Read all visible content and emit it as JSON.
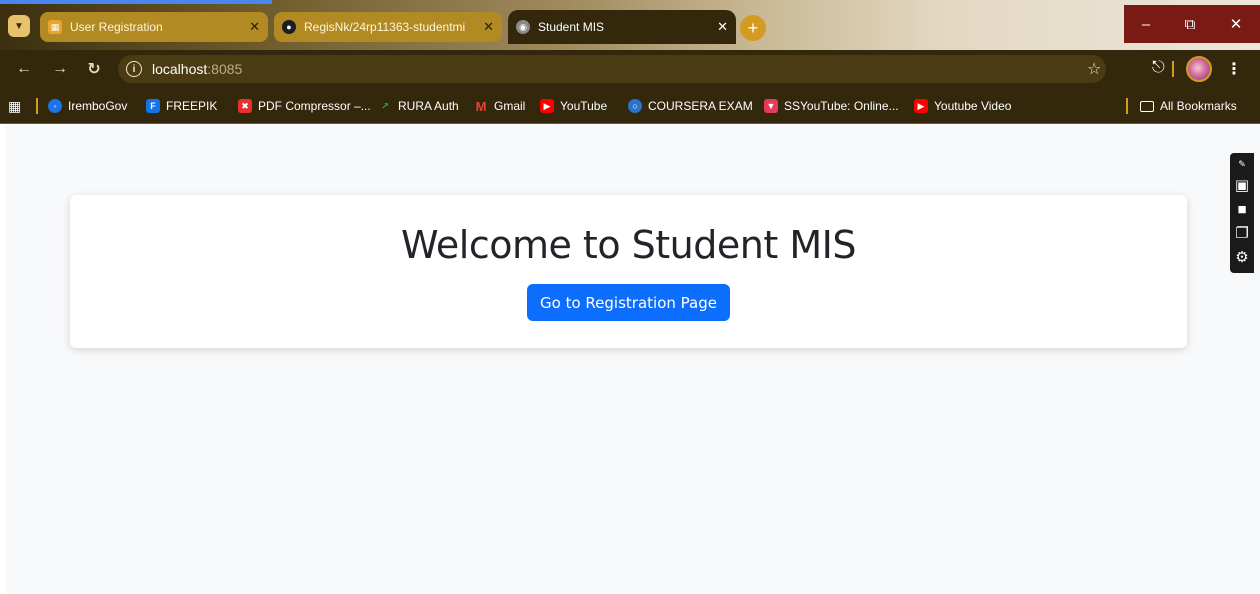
{
  "tabs": [
    {
      "title": "User Registration",
      "favicon": "registration-favicon",
      "favicon_color": "#e8a526",
      "active": false
    },
    {
      "title": "RegisNk/24rp11363-studentmi",
      "favicon": "github-favicon",
      "favicon_color": "#1b1f23",
      "active": false
    },
    {
      "title": "Student MIS",
      "favicon": "globe-favicon",
      "favicon_color": "#8a8a8a",
      "active": true
    }
  ],
  "toolbar": {
    "url_host": "localhost",
    "url_port": ":8085"
  },
  "bookmarks": [
    {
      "label": "IremboGov",
      "icon": "irembo-icon",
      "color": "#1a73e8"
    },
    {
      "label": "FREEPIK",
      "icon": "freepik-icon",
      "color": "#1273eb"
    },
    {
      "label": "PDF Compressor –...",
      "icon": "pdf-compressor-icon",
      "color": "#e5322d"
    },
    {
      "label": "RURA Auth",
      "icon": "rura-icon",
      "color": "#34a853"
    },
    {
      "label": "Gmail",
      "icon": "gmail-icon",
      "color": "#ea4335"
    },
    {
      "label": "YouTube",
      "icon": "youtube-icon",
      "color": "#ff0000"
    },
    {
      "label": "COURSERA EXAM",
      "icon": "coursera-icon",
      "color": "#2a73cc"
    },
    {
      "label": "SSYouTube: Online...",
      "icon": "ssyoutube-icon",
      "color": "#e53a5a"
    },
    {
      "label": "Youtube Video",
      "icon": "youtube-icon",
      "color": "#ff0000"
    }
  ],
  "all_bookmarks_label": "All Bookmarks",
  "page": {
    "title": "Welcome to Student MIS",
    "button_label": "Go to Registration Page",
    "accent": "#0d6efd",
    "background": "#f8f9fa"
  }
}
